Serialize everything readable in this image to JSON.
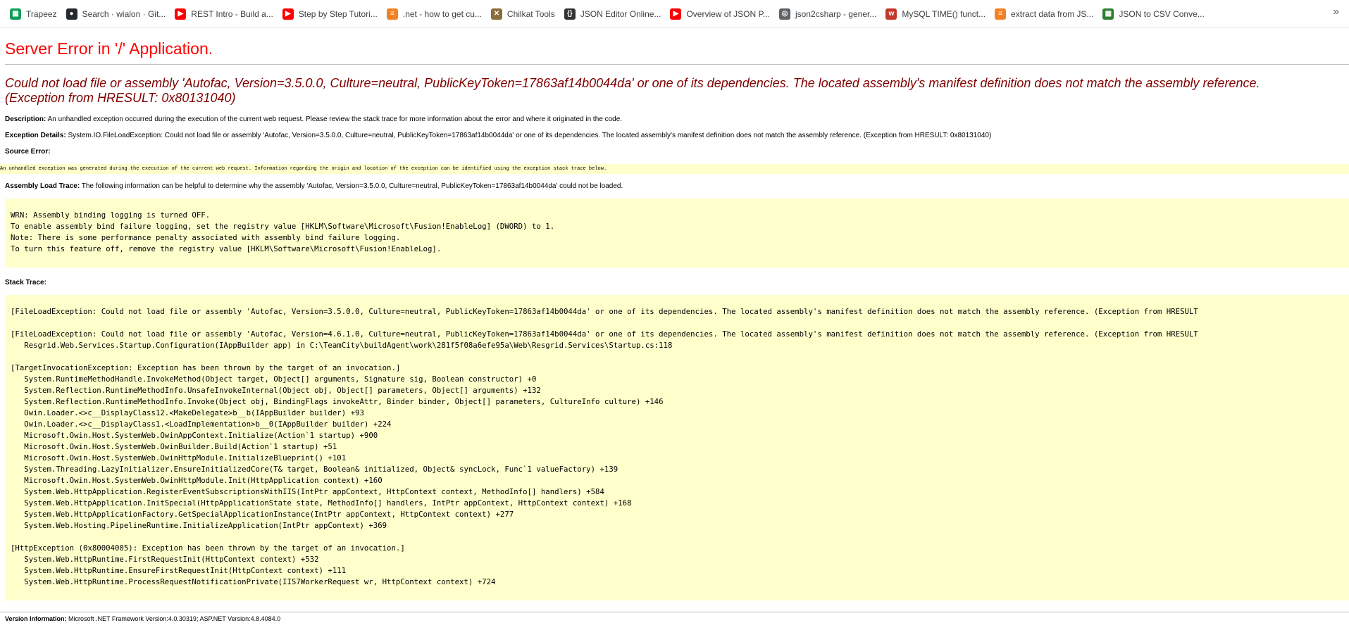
{
  "bookmarks": [
    {
      "label": "Trapeez",
      "icon": "sheets-icon",
      "color": "#0f9d58",
      "glyph": "▦"
    },
    {
      "label": "Search · wialon · Git...",
      "icon": "github-icon",
      "color": "#24292e",
      "glyph": "●"
    },
    {
      "label": "REST Intro - Build a...",
      "icon": "youtube-icon",
      "color": "#ff0000",
      "glyph": "▶"
    },
    {
      "label": "Step by Step Tutori...",
      "icon": "youtube-icon",
      "color": "#ff0000",
      "glyph": "▶"
    },
    {
      "label": ".net - how to get cu...",
      "icon": "stackoverflow-icon",
      "color": "#f48024",
      "glyph": "≡"
    },
    {
      "label": "Chilkat Tools",
      "icon": "tools-icon",
      "color": "#8a6d3b",
      "glyph": "✕"
    },
    {
      "label": "JSON Editor Online...",
      "icon": "json-editor-icon",
      "color": "#333333",
      "glyph": "{}"
    },
    {
      "label": "Overview of JSON P...",
      "icon": "youtube-icon",
      "color": "#ff0000",
      "glyph": "▶"
    },
    {
      "label": "json2csharp - gener...",
      "icon": "globe-icon",
      "color": "#5f6368",
      "glyph": "◎"
    },
    {
      "label": "MySQL TIME() funct...",
      "icon": "w3resource-icon",
      "color": "#c0392b",
      "glyph": "w"
    },
    {
      "label": "extract data from JS...",
      "icon": "stackoverflow-icon",
      "color": "#f48024",
      "glyph": "≡"
    },
    {
      "label": "JSON to CSV Conve...",
      "icon": "csv-icon",
      "color": "#2e7d32",
      "glyph": "▦"
    }
  ],
  "page": {
    "title": "Server Error in '/' Application.",
    "message": "Could not load file or assembly 'Autofac, Version=3.5.0.0, Culture=neutral, PublicKeyToken=17863af14b0044da' or one of its dependencies. The located assembly's manifest definition does not match the assembly reference.",
    "message2": "(Exception from HRESULT: 0x80131040)",
    "description_label": "Description:",
    "description": "An unhandled exception occurred during the execution of the current web request. Please review the stack trace for more information about the error and where it originated in the code.",
    "exception_label": "Exception Details:",
    "exception": "System.IO.FileLoadException: Could not load file or assembly 'Autofac, Version=3.5.0.0, Culture=neutral, PublicKeyToken=17863af14b0044da' or one of its dependencies. The located assembly's manifest definition does not match the assembly reference. (Exception from HRESULT: 0x80131040)",
    "source_label": "Source Error:",
    "source": "An unhandled exception was generated during the execution of the current web request. Information regarding the origin and location of the exception can be identified using the exception stack trace below.",
    "assembly_label": "Assembly Load Trace:",
    "assembly": "The following information can be helpful to determine why the assembly 'Autofac, Version=3.5.0.0, Culture=neutral, PublicKeyToken=17863af14b0044da' could not be loaded.",
    "assembly_trace": "WRN: Assembly binding logging is turned OFF.\nTo enable assembly bind failure logging, set the registry value [HKLM\\Software\\Microsoft\\Fusion!EnableLog] (DWORD) to 1.\nNote: There is some performance penalty associated with assembly bind failure logging.\nTo turn this feature off, remove the registry value [HKLM\\Software\\Microsoft\\Fusion!EnableLog].",
    "stack_label": "Stack Trace:",
    "stack_trace": "[FileLoadException: Could not load file or assembly 'Autofac, Version=3.5.0.0, Culture=neutral, PublicKeyToken=17863af14b0044da' or one of its dependencies. The located assembly's manifest definition does not match the assembly reference. (Exception from HRESULT\n\n[FileLoadException: Could not load file or assembly 'Autofac, Version=4.6.1.0, Culture=neutral, PublicKeyToken=17863af14b0044da' or one of its dependencies. The located assembly's manifest definition does not match the assembly reference. (Exception from HRESULT\n   Resgrid.Web.Services.Startup.Configuration(IAppBuilder app) in C:\\TeamCity\\buildAgent\\work\\281f5f08a6efe95a\\Web\\Resgrid.Services\\Startup.cs:118\n\n[TargetInvocationException: Exception has been thrown by the target of an invocation.]\n   System.RuntimeMethodHandle.InvokeMethod(Object target, Object[] arguments, Signature sig, Boolean constructor) +0\n   System.Reflection.RuntimeMethodInfo.UnsafeInvokeInternal(Object obj, Object[] parameters, Object[] arguments) +132\n   System.Reflection.RuntimeMethodInfo.Invoke(Object obj, BindingFlags invokeAttr, Binder binder, Object[] parameters, CultureInfo culture) +146\n   Owin.Loader.<>c__DisplayClass12.<MakeDelegate>b__b(IAppBuilder builder) +93\n   Owin.Loader.<>c__DisplayClass1.<LoadImplementation>b__0(IAppBuilder builder) +224\n   Microsoft.Owin.Host.SystemWeb.OwinAppContext.Initialize(Action`1 startup) +900\n   Microsoft.Owin.Host.SystemWeb.OwinBuilder.Build(Action`1 startup) +51\n   Microsoft.Owin.Host.SystemWeb.OwinHttpModule.InitializeBlueprint() +101\n   System.Threading.LazyInitializer.EnsureInitializedCore(T& target, Boolean& initialized, Object& syncLock, Func`1 valueFactory) +139\n   Microsoft.Owin.Host.SystemWeb.OwinHttpModule.Init(HttpApplication context) +160\n   System.Web.HttpApplication.RegisterEventSubscriptionsWithIIS(IntPtr appContext, HttpContext context, MethodInfo[] handlers) +584\n   System.Web.HttpApplication.InitSpecial(HttpApplicationState state, MethodInfo[] handlers, IntPtr appContext, HttpContext context) +168\n   System.Web.HttpApplicationFactory.GetSpecialApplicationInstance(IntPtr appContext, HttpContext context) +277\n   System.Web.Hosting.PipelineRuntime.InitializeApplication(IntPtr appContext) +369\n\n[HttpException (0x80004005): Exception has been thrown by the target of an invocation.]\n   System.Web.HttpRuntime.FirstRequestInit(HttpContext context) +532\n   System.Web.HttpRuntime.EnsureFirstRequestInit(HttpContext context) +111\n   System.Web.HttpRuntime.ProcessRequestNotificationPrivate(IIS7WorkerRequest wr, HttpContext context) +724",
    "version_label": "Version Information:",
    "version": "Microsoft .NET Framework Version:4.0.30319; ASP.NET Version:4.8.4084.0"
  },
  "colors": {
    "title": "#ff0000",
    "message": "#800000",
    "trace_background": "#ffffcc"
  },
  "ui": {
    "more_glyph": "»"
  }
}
